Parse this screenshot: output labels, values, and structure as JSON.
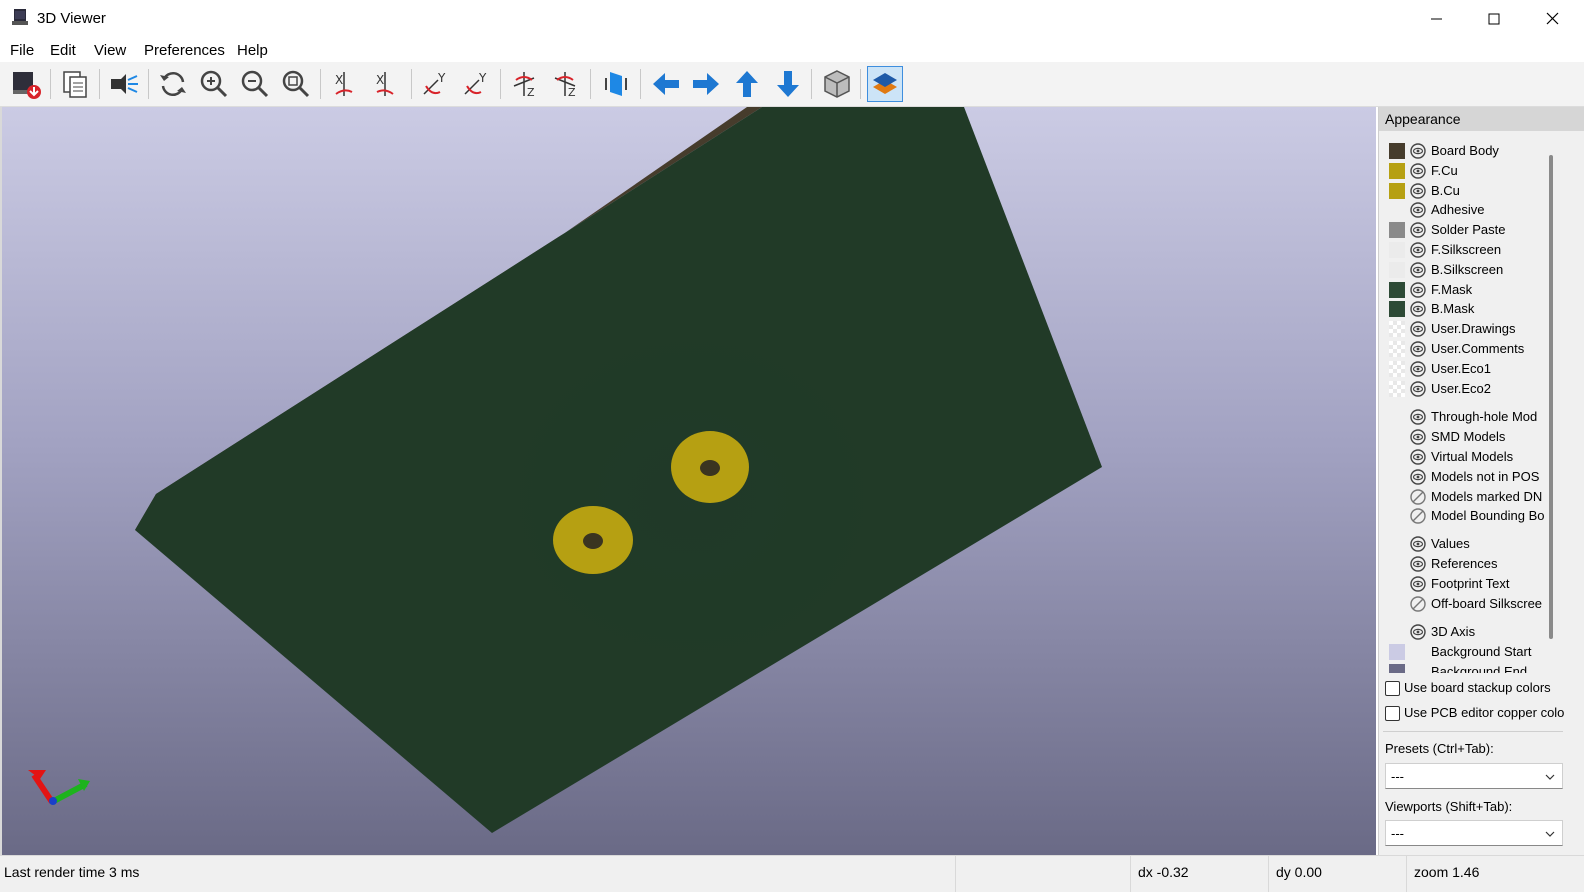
{
  "window": {
    "title": "3D Viewer"
  },
  "menu": [
    {
      "label": "File"
    },
    {
      "label": "Edit"
    },
    {
      "label": "View"
    },
    {
      "label": "Preferences"
    },
    {
      "label": "Help"
    }
  ],
  "toolbar": {
    "buttons": [
      {
        "name": "export-image-button",
        "icon": "export-icon"
      },
      {
        "name": "copy-to-clipboard-button",
        "icon": "copy-icon"
      },
      {
        "name": "raytracing-button",
        "icon": "raytrace-icon"
      },
      {
        "name": "redraw-button",
        "icon": "refresh-icon"
      },
      {
        "name": "zoom-in-button",
        "icon": "zoom-in-icon"
      },
      {
        "name": "zoom-out-button",
        "icon": "zoom-out-icon"
      },
      {
        "name": "zoom-fit-button",
        "icon": "zoom-fit-icon"
      },
      {
        "name": "rotate-x-cw-button",
        "icon": "rotate-x-cw-icon"
      },
      {
        "name": "rotate-x-ccw-button",
        "icon": "rotate-x-ccw-icon"
      },
      {
        "name": "rotate-y-cw-button",
        "icon": "rotate-y-cw-icon"
      },
      {
        "name": "rotate-y-ccw-button",
        "icon": "rotate-y-ccw-icon"
      },
      {
        "name": "rotate-z-cw-button",
        "icon": "rotate-z-cw-icon"
      },
      {
        "name": "rotate-z-ccw-button",
        "icon": "rotate-z-ccw-icon"
      },
      {
        "name": "flip-board-button",
        "icon": "flip-board-icon"
      },
      {
        "name": "move-left-button",
        "icon": "arrow-left-icon"
      },
      {
        "name": "move-right-button",
        "icon": "arrow-right-icon"
      },
      {
        "name": "move-up-button",
        "icon": "arrow-up-icon"
      },
      {
        "name": "move-down-button",
        "icon": "arrow-down-icon"
      },
      {
        "name": "toggle-orthographic-button",
        "icon": "ortho-cube-icon"
      },
      {
        "name": "toggle-layers-manager-button",
        "icon": "layers-icon"
      }
    ]
  },
  "panel": {
    "title": "Appearance",
    "layers": [
      {
        "label": "Board Body",
        "color": "#463c2c",
        "visible": "eye"
      },
      {
        "label": "F.Cu",
        "color": "#b6a012",
        "visible": "eye"
      },
      {
        "label": "B.Cu",
        "color": "#b6a012",
        "visible": "eye"
      },
      {
        "label": "Adhesive",
        "color": "",
        "visible": "eye"
      },
      {
        "label": "Solder Paste",
        "color": "#8a8a8a",
        "visible": "eye"
      },
      {
        "label": "F.Silkscreen",
        "color": "#ebebeb",
        "visible": "eye"
      },
      {
        "label": "B.Silkscreen",
        "color": "#ebebeb",
        "visible": "eye"
      },
      {
        "label": "F.Mask",
        "color": "#2d4a36",
        "visible": "eye"
      },
      {
        "label": "B.Mask",
        "color": "#2d4a36",
        "visible": "eye"
      },
      {
        "label": "User.Drawings",
        "color": "checker",
        "visible": "eye"
      },
      {
        "label": "User.Comments",
        "color": "checker",
        "visible": "eye"
      },
      {
        "label": "User.Eco1",
        "color": "checker",
        "visible": "eye"
      },
      {
        "label": "User.Eco2",
        "color": "checker",
        "visible": "eye"
      },
      {
        "label": "Through-hole Mod",
        "color": "",
        "visible": "eye"
      },
      {
        "label": "SMD Models",
        "color": "",
        "visible": "eye"
      },
      {
        "label": "Virtual Models",
        "color": "",
        "visible": "eye"
      },
      {
        "label": "Models not in POS",
        "color": "",
        "visible": "eye"
      },
      {
        "label": "Models marked DN",
        "color": "",
        "visible": "hidden"
      },
      {
        "label": "Model Bounding Bo",
        "color": "",
        "visible": "hidden"
      },
      {
        "label": "Values",
        "color": "",
        "visible": "eye"
      },
      {
        "label": "References",
        "color": "",
        "visible": "eye"
      },
      {
        "label": "Footprint Text",
        "color": "",
        "visible": "eye"
      },
      {
        "label": "Off-board Silkscree",
        "color": "",
        "visible": "hidden"
      },
      {
        "label": "3D Axis",
        "color": "",
        "visible": "eye"
      },
      {
        "label": "Background Start",
        "color": "#cbcbe4",
        "visible": "none"
      },
      {
        "label": "Background End",
        "color": "#6a6a86",
        "visible": "none"
      }
    ],
    "checkboxes": [
      {
        "label": "Use board stackup colors",
        "checked": false
      },
      {
        "label": "Use PCB editor copper colo",
        "checked": false
      }
    ],
    "presets_label": "Presets (Ctrl+Tab):",
    "presets_value": "---",
    "viewports_label": "Viewports (Shift+Tab):",
    "viewports_value": "---"
  },
  "status": {
    "render_time": "Last render time 3 ms",
    "dx": "dx -0.32",
    "dy": "dy 0.00",
    "zoom": "zoom 1.46"
  },
  "colors": {
    "board_mask": "#213a27",
    "board_edge": "#463c2c",
    "pad": "#b6a012",
    "hole": "#3a3420"
  }
}
